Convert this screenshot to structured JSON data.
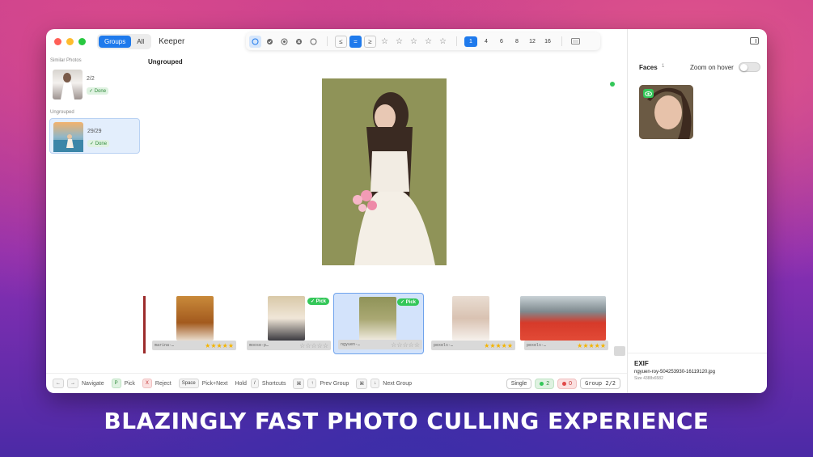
{
  "window": {
    "app_name": "Keeper",
    "view_tabs": [
      "Groups",
      "All"
    ],
    "active_view": "Groups"
  },
  "toolbar": {
    "filter_icons": [
      "circle-outline-icon",
      "check-circle-icon",
      "reject-circle-icon",
      "x-circle-icon",
      "empty-circle-icon"
    ],
    "compare_ops": [
      "≤",
      "=",
      "≥"
    ],
    "stars": [
      "☆",
      "☆",
      "☆",
      "☆",
      "☆"
    ],
    "grid_sizes": [
      "1",
      "4",
      "6",
      "8",
      "12",
      "16"
    ],
    "active_grid": "1"
  },
  "sidebar": {
    "sections": [
      {
        "label": "Similar Photos",
        "count": "2/2",
        "status": "✓ Done"
      },
      {
        "label": "Ungrouped",
        "count": "29/29",
        "status": "✓ Done"
      }
    ]
  },
  "main": {
    "title": "Ungrouped",
    "filmstrip": [
      {
        "name": "marina-…",
        "stars": 5,
        "pick": false,
        "label": ""
      },
      {
        "name": "moose-p…",
        "stars": 0,
        "pick": true,
        "label": "✓ Pick"
      },
      {
        "name": "ngyuen-…",
        "stars": 0,
        "pick": true,
        "label": "✓ Pick"
      },
      {
        "name": "pexels-…",
        "stars": 5,
        "pick": false,
        "label": ""
      },
      {
        "name": "pexels-…",
        "stars": 5,
        "pick": false,
        "label": ""
      }
    ]
  },
  "bottom": {
    "hints": [
      {
        "keys": [
          "←",
          "→"
        ],
        "label": "Navigate"
      },
      {
        "keys": [
          "P"
        ],
        "label": "Pick"
      },
      {
        "keys": [
          "X"
        ],
        "label": "Reject"
      },
      {
        "keys": [
          "Space"
        ],
        "label": "Pick+Next"
      },
      {
        "keys": [
          "/"
        ],
        "prefix": "Hold",
        "label": "Shortcuts"
      },
      {
        "keys": [
          "⌘",
          "↑"
        ],
        "label": "Prev Group"
      },
      {
        "keys": [
          "⌘",
          "↓"
        ],
        "label": "Next Group"
      }
    ],
    "mode": "Single",
    "picked_count": "2",
    "rejected_count": "0",
    "group_indicator": "Group 2/2"
  },
  "right_panel": {
    "faces_label": "Faces",
    "faces_count": "1",
    "zoom_label": "Zoom on hover",
    "exif_title": "EXIF",
    "exif_file": "ngyuen-roy-504253930-16119120.jpg",
    "exif_size": "Size 4388x6582"
  },
  "tagline": "BLAZINGLY FAST PHOTO CULLING EXPERIENCE",
  "colors": {
    "accent": "#1f7aec",
    "pick_green": "#34c759",
    "reject_red": "#e04848",
    "star_gold": "#f4b400"
  }
}
